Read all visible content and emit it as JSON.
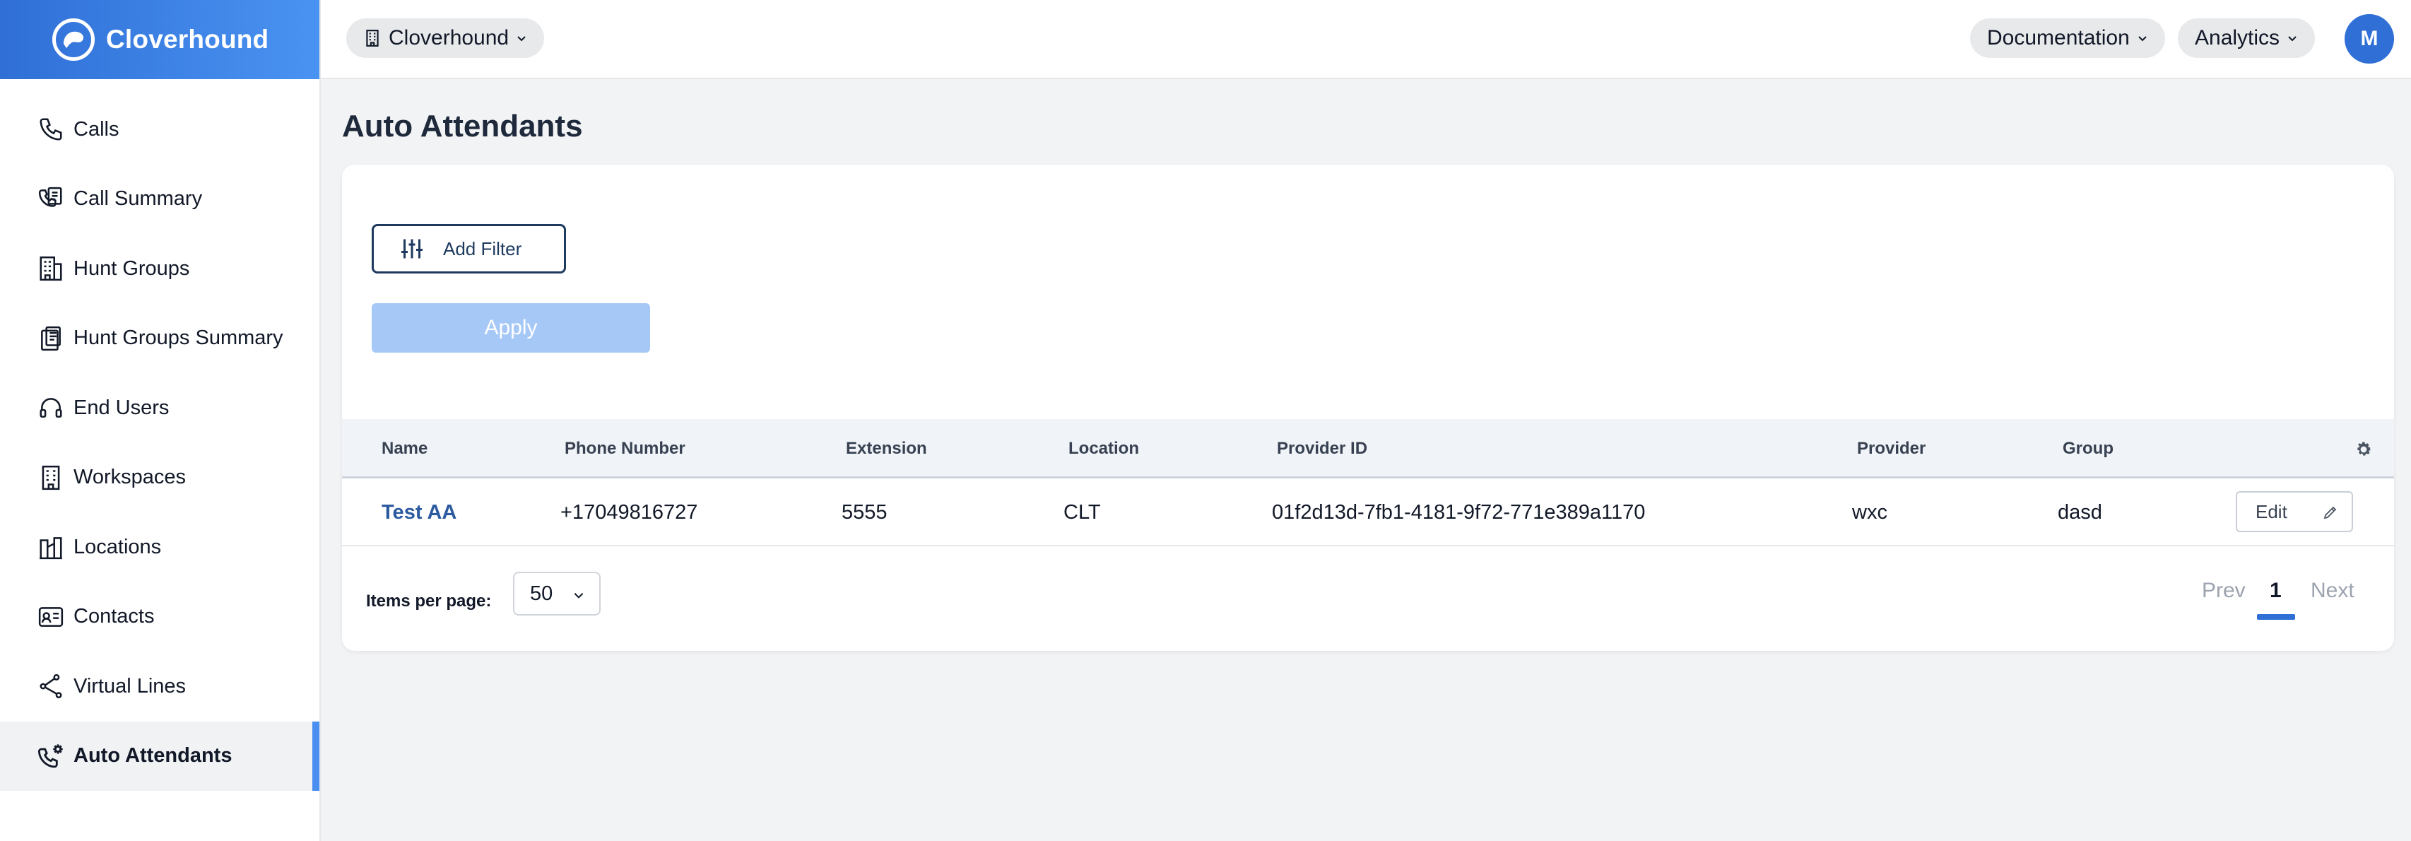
{
  "brand": {
    "name": "Cloverhound",
    "color": "#2f6fd6"
  },
  "sidebar": {
    "items": [
      {
        "label": "Calls",
        "icon": "phone-icon"
      },
      {
        "label": "Call Summary",
        "icon": "call-summary-icon"
      },
      {
        "label": "Hunt Groups",
        "icon": "building-icon"
      },
      {
        "label": "Hunt Groups Summary",
        "icon": "clipboard-icon"
      },
      {
        "label": "End Users",
        "icon": "headset-icon"
      },
      {
        "label": "Workspaces",
        "icon": "office-building-icon"
      },
      {
        "label": "Locations",
        "icon": "city-icon"
      },
      {
        "label": "Contacts",
        "icon": "contact-card-icon"
      },
      {
        "label": "Virtual Lines",
        "icon": "share-nodes-icon"
      },
      {
        "label": "Auto Attendants",
        "icon": "phone-gear-icon",
        "active": true
      }
    ]
  },
  "topbar": {
    "org": "Cloverhound",
    "documentation": "Documentation",
    "analytics": "Analytics",
    "avatar_initial": "M"
  },
  "page": {
    "title": "Auto Attendants"
  },
  "filters": {
    "add_filter_label": "Add Filter",
    "apply_label": "Apply"
  },
  "table": {
    "columns": [
      "Name",
      "Phone Number",
      "Extension",
      "Location",
      "Provider ID",
      "Provider",
      "Group"
    ],
    "rows": [
      {
        "name": "Test AA",
        "phone": "+17049816727",
        "extension": "5555",
        "location": "CLT",
        "provider_id": "01f2d13d-7fb1-4181-9f72-771e389a1170",
        "provider": "wxc",
        "group": "dasd",
        "edit_label": "Edit"
      }
    ]
  },
  "pagination": {
    "items_per_page_label": "Items per page:",
    "items_per_page_value": "50",
    "prev_label": "Prev",
    "current_page": "1",
    "next_label": "Next"
  }
}
